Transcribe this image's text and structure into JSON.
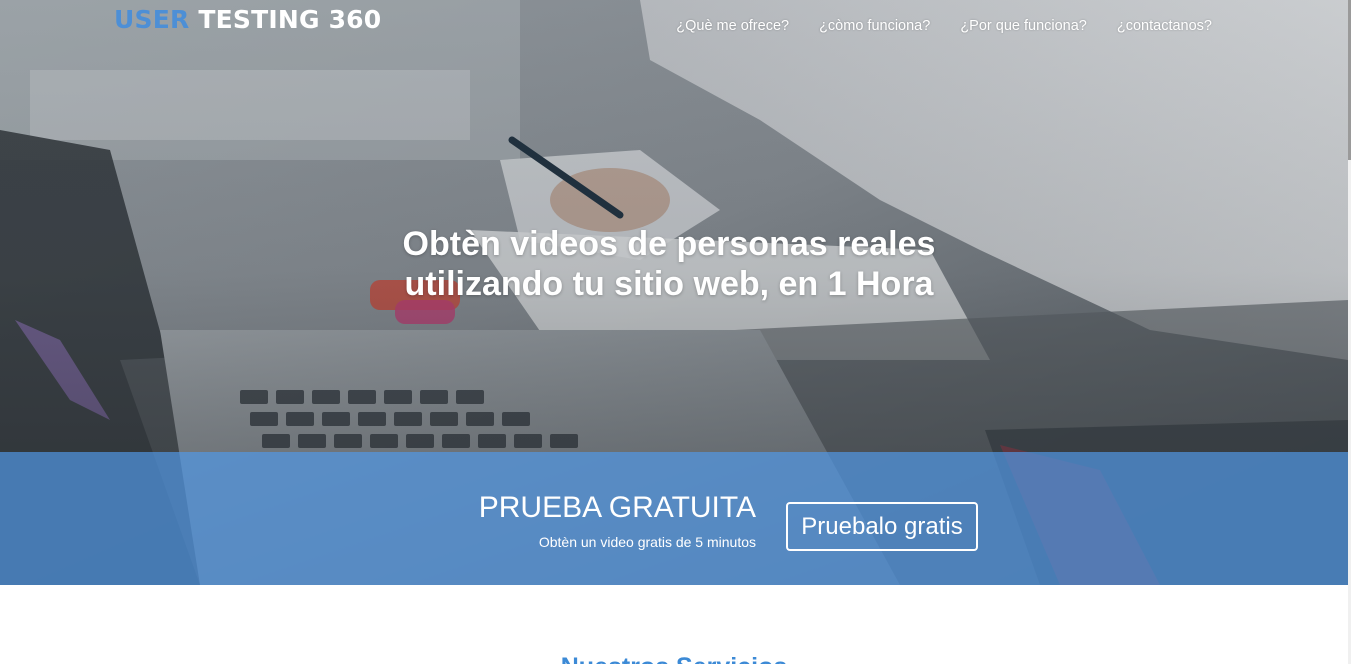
{
  "brand": {
    "part_a": "USER",
    "part_b": " TESTING 360"
  },
  "nav": {
    "items": [
      {
        "label": "¿Què me ofrece?"
      },
      {
        "label": "¿còmo funciona?"
      },
      {
        "label": "¿Por que funciona?"
      },
      {
        "label": "¿contactanos?"
      }
    ]
  },
  "hero": {
    "title_line1": "Obtèn videos de personas reales",
    "title_line2": "utilizando tu sitio web, en 1 Hora"
  },
  "cta": {
    "title": "PRUEBA GRATUITA",
    "subtitle": "Obtèn un video gratis de 5 minutos",
    "button_label": "Pruebalo gratis"
  },
  "services": {
    "heading": "Nuestros Servicios"
  },
  "colors": {
    "brand_blue": "#4d8fd6",
    "cta_band": "#4a88cd",
    "services_heading": "#3c8ad6"
  }
}
